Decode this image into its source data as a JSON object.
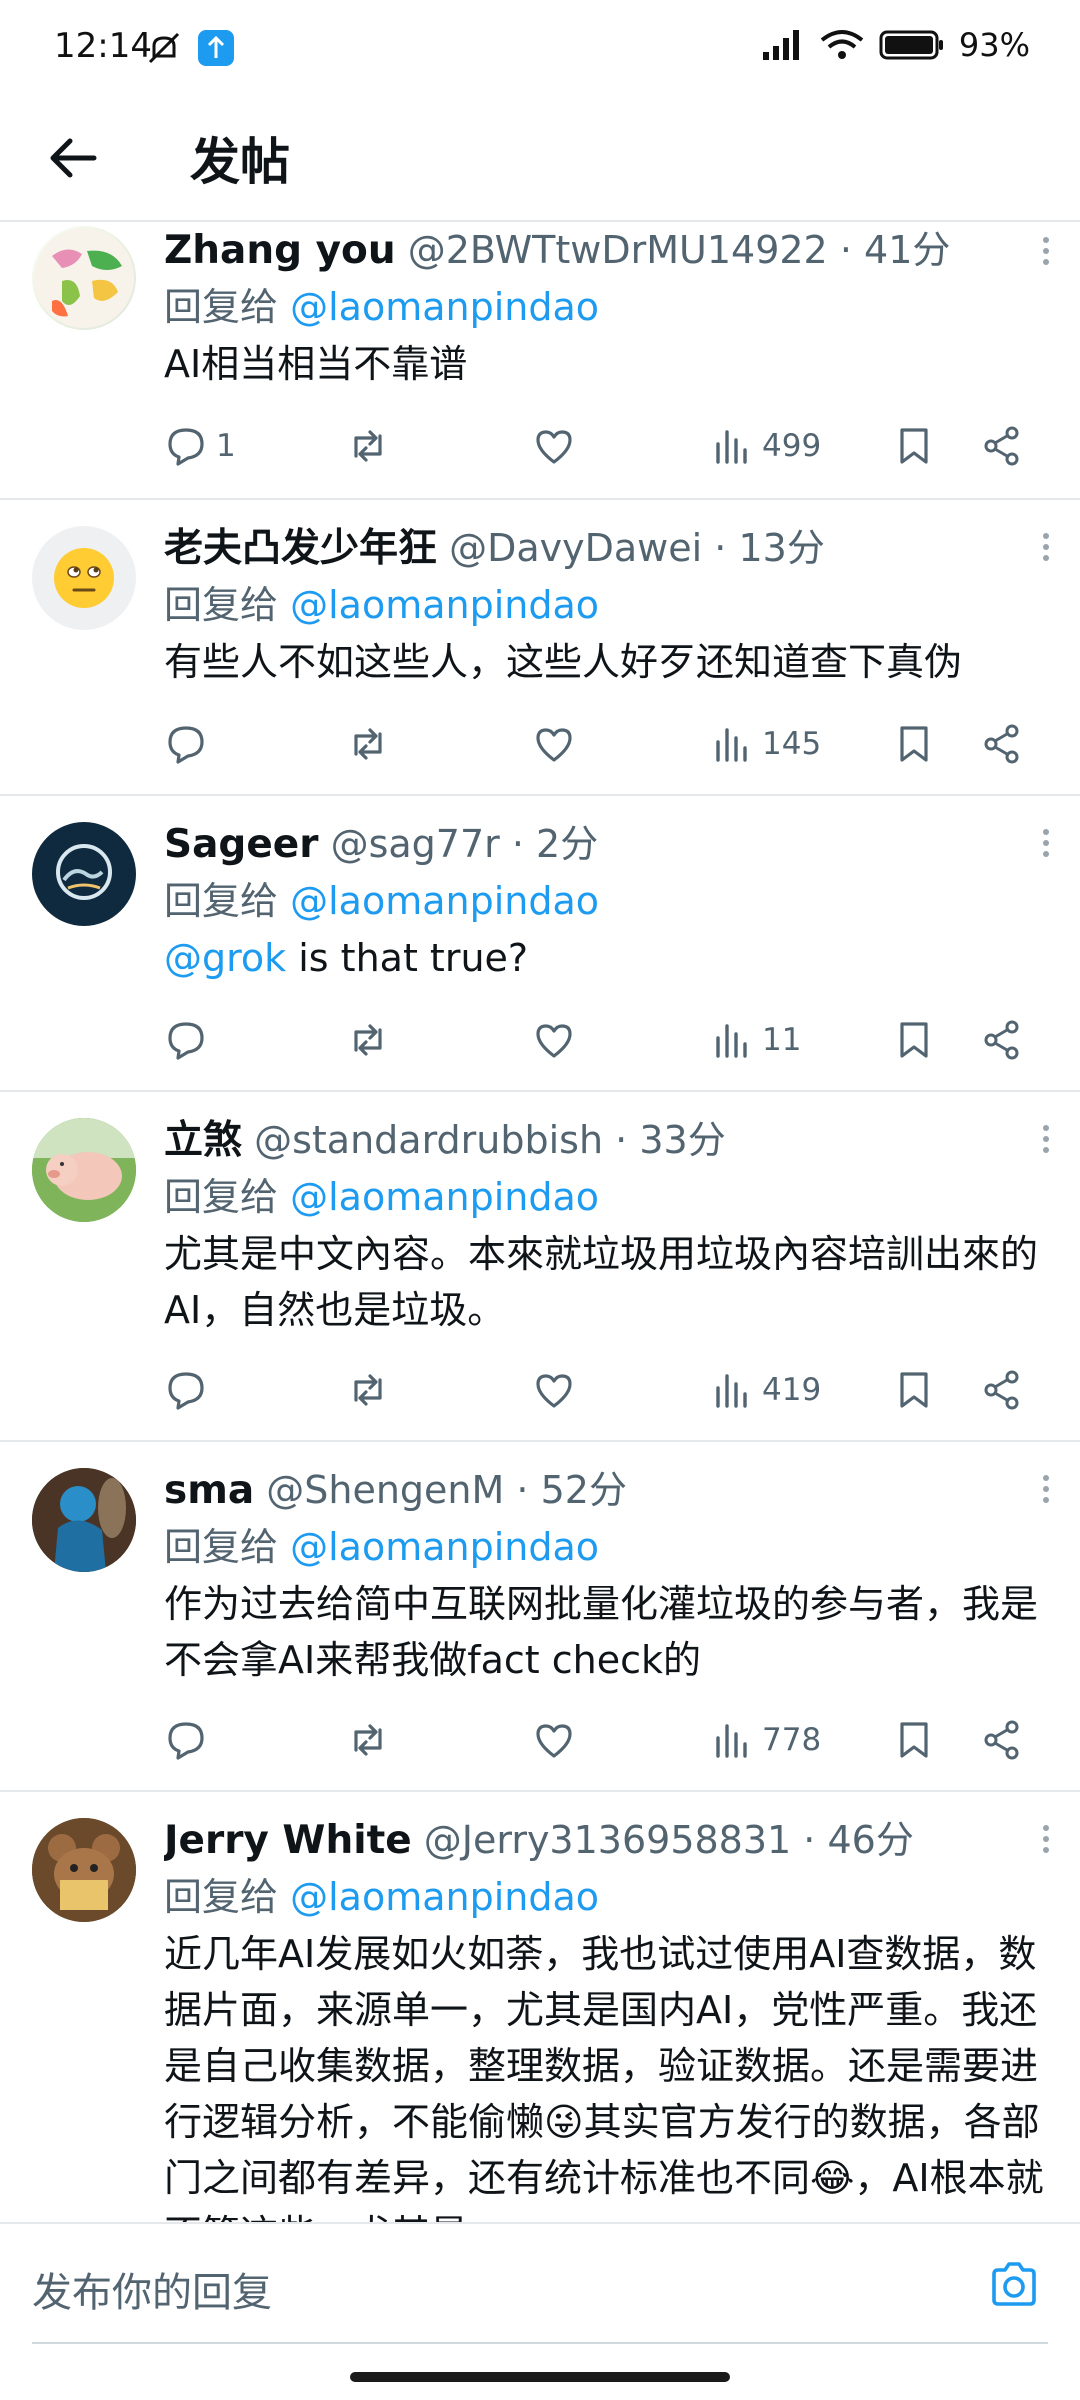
{
  "status_bar": {
    "time": "12:14",
    "battery": "93%"
  },
  "header": {
    "title": "发帖"
  },
  "reply_prefix": "回复给",
  "tweets": [
    {
      "name": "Zhang you",
      "handle": "@2BWTtwDrMU14922",
      "time": "41分",
      "reply_to": "@laomanpindao",
      "text": "AI相当相当不靠谱",
      "replies": "1",
      "views": "499"
    },
    {
      "name": "老夫凸发少年狂",
      "handle": "@DavyDawei",
      "time": "13分",
      "reply_to": "@laomanpindao",
      "text": "有些人不如这些人，这些人好歹还知道查下真伪",
      "replies": "",
      "views": "145"
    },
    {
      "name": "Sageer",
      "handle": "@sag77r",
      "time": "2分",
      "reply_to": "@laomanpindao",
      "mention": "@grok",
      "text": " is that true?",
      "replies": "",
      "views": "11"
    },
    {
      "name": "立煞",
      "handle": "@standardrubbish",
      "time": "33分",
      "reply_to": "@laomanpindao",
      "text": "尤其是中文內容。本來就垃圾用垃圾內容培訓出來的AI，自然也是垃圾。",
      "replies": "",
      "views": "419"
    },
    {
      "name": "sma",
      "handle": "@ShengenM",
      "time": "52分",
      "reply_to": "@laomanpindao",
      "text": "作为过去给简中互联网批量化灌垃圾的参与者，我是不会拿AI来帮我做fact check的",
      "replies": "",
      "views": "778"
    },
    {
      "name": "Jerry White",
      "handle": "@Jerry3136958831",
      "time": "46分",
      "reply_to": "@laomanpindao",
      "text": "近几年AI发展如火如荼，我也试过使用AI查数据，数据片面，来源单一，尤其是国内AI，党性严重。我还是自己收集数据，整理数据，验证数据。还是需要进行逻辑分析，不能偷懒😜其实官方发行的数据，各部门之间都有差异，还有统计标准也不同😂，AI根本就不管这些，尤其是",
      "replies": "",
      "views": ""
    }
  ],
  "composer": {
    "placeholder": "发布你的回复"
  },
  "icons": {
    "reply": "reply-icon",
    "retweet": "retweet-icon",
    "like": "heart-icon",
    "views": "views-icon",
    "bookmark": "bookmark-icon",
    "share": "share-icon",
    "back": "back-arrow-icon",
    "camera": "camera-icon",
    "more": "more-vertical-icon"
  },
  "colors": {
    "accent": "#1d9bf0",
    "secondary_text": "#536471",
    "divider": "#e6e9eb"
  }
}
